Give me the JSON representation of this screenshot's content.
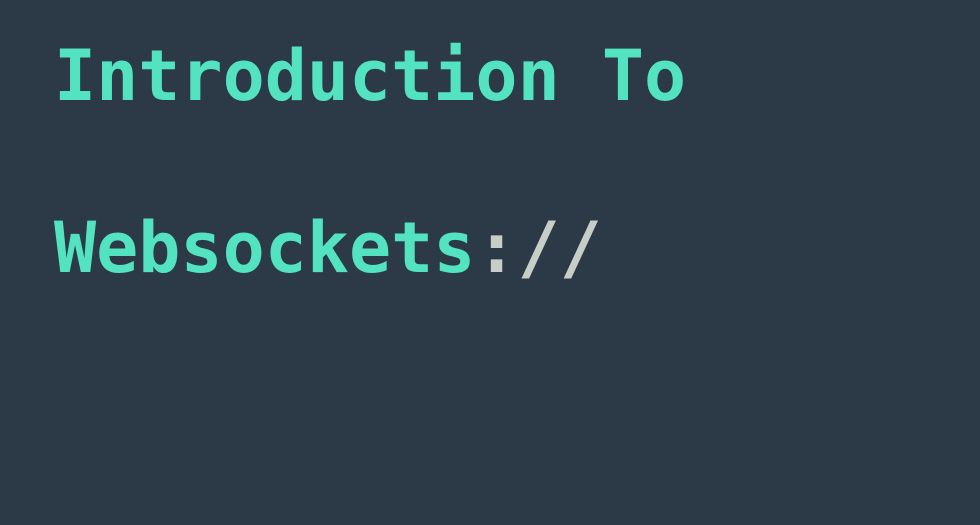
{
  "title": {
    "line1": "Introduction To",
    "line2_main": "Websockets",
    "line2_suffix": "://"
  },
  "colors": {
    "background": "#2c3a48",
    "accent": "#54e3c0",
    "punctuation": "#c7cec8"
  }
}
